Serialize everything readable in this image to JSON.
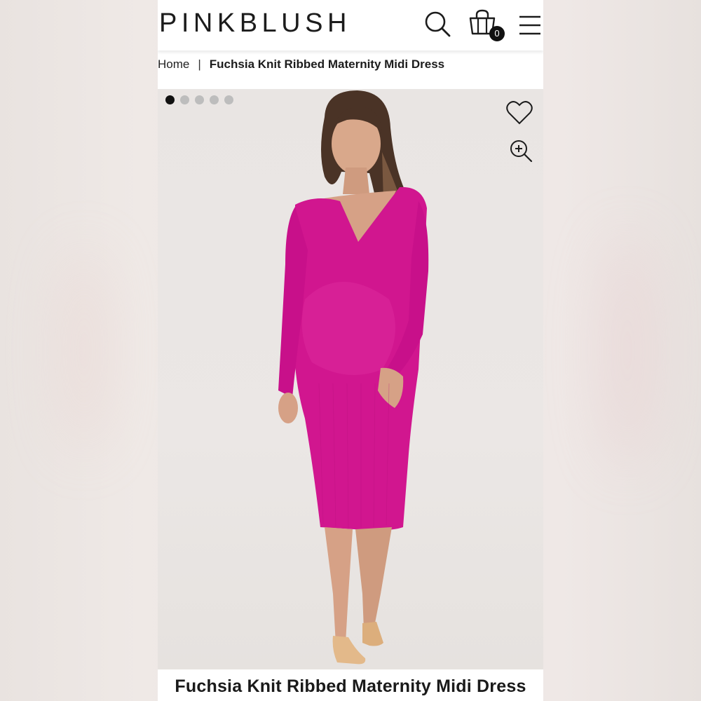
{
  "header": {
    "logo": "PINKBLUSH",
    "cart_count": "0",
    "icons": [
      "search-icon",
      "shopping-bag-icon",
      "menu-icon"
    ]
  },
  "breadcrumb": {
    "home": "Home",
    "separator": "|",
    "current": "Fuchsia Knit Ribbed Maternity Midi Dress"
  },
  "gallery": {
    "image_count": 5,
    "active_index": 0,
    "icons": [
      "heart-icon",
      "zoom-in-icon"
    ]
  },
  "product": {
    "title": "Fuchsia Knit Ribbed Maternity Midi Dress",
    "dress_color": "#d1168f"
  }
}
